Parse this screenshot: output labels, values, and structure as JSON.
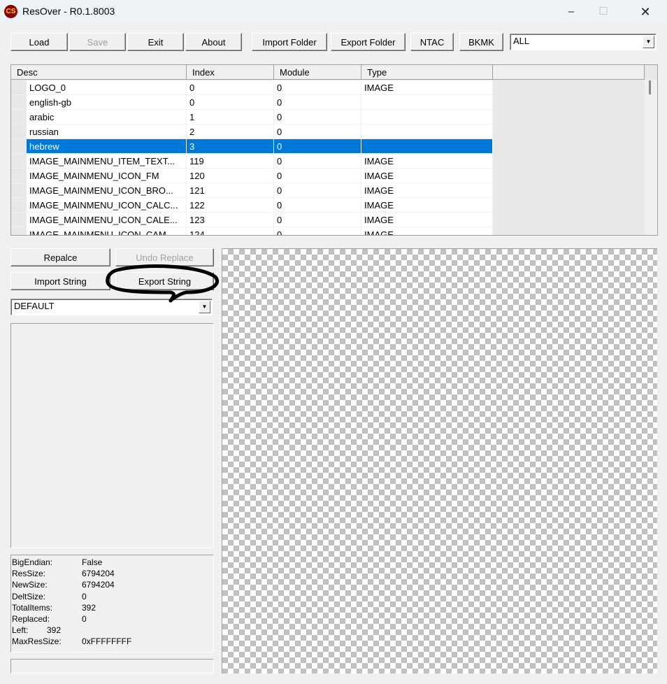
{
  "window": {
    "title": "ResOver - R0.1.8003",
    "icon": "app-logo-icon",
    "controls": [
      "minimize-icon",
      "maximize-icon",
      "close-icon"
    ]
  },
  "toolbar": {
    "load": "Load",
    "save": "Save",
    "exit": "Exit",
    "about": "About",
    "import_folder": "Import Folder",
    "export_folder": "Export Folder",
    "ntac": "NTAC",
    "bkmk": "BKMK",
    "filter_value": "ALL"
  },
  "grid": {
    "columns": [
      "Desc",
      "Index",
      "Module",
      "Type"
    ],
    "rows": [
      {
        "desc": "LOGO_0",
        "index": "0",
        "module": "0",
        "type": "IMAGE"
      },
      {
        "desc": "english-gb",
        "index": "0",
        "module": "0",
        "type": ""
      },
      {
        "desc": "arabic",
        "index": "1",
        "module": "0",
        "type": ""
      },
      {
        "desc": "russian",
        "index": "2",
        "module": "0",
        "type": ""
      },
      {
        "desc": "hebrew",
        "index": "3",
        "module": "0",
        "type": "",
        "selected": true
      },
      {
        "desc": "IMAGE_MAINMENU_ITEM_TEXT...",
        "index": "119",
        "module": "0",
        "type": "IMAGE"
      },
      {
        "desc": "IMAGE_MAINMENU_ICON_FM",
        "index": "120",
        "module": "0",
        "type": "IMAGE"
      },
      {
        "desc": "IMAGE_MAINMENU_ICON_BRO...",
        "index": "121",
        "module": "0",
        "type": "IMAGE"
      },
      {
        "desc": "IMAGE_MAINMENU_ICON_CALC...",
        "index": "122",
        "module": "0",
        "type": "IMAGE"
      },
      {
        "desc": "IMAGE_MAINMENU_ICON_CALE...",
        "index": "123",
        "module": "0",
        "type": "IMAGE"
      },
      {
        "desc": "IMAGE_MAINMENU_ICON_CAM...",
        "index": "124",
        "module": "0",
        "type": "IMAGE"
      }
    ],
    "selected_color": "#0078d7"
  },
  "left": {
    "replace": "Repalce",
    "undo_replace": "Undo Replace",
    "import_string": "Import String",
    "export_string": "Export String",
    "language_value": "DEFAULT"
  },
  "info": [
    {
      "label": "BigEndian:",
      "value": "False"
    },
    {
      "label": "ResSize:",
      "value": "6794204"
    },
    {
      "label": "NewSize:",
      "value": "6794204"
    },
    {
      "label": "DeltSize:",
      "value": "0"
    },
    {
      "label": "TotalItems:",
      "value": "392"
    },
    {
      "label": "Replaced:",
      "value": "0"
    },
    {
      "label": "Left:",
      "value": "392"
    },
    {
      "label": "MaxResSize:",
      "value": "0xFFFFFFFF"
    }
  ],
  "annotation": {
    "color": "#000000",
    "target": "Export String"
  }
}
